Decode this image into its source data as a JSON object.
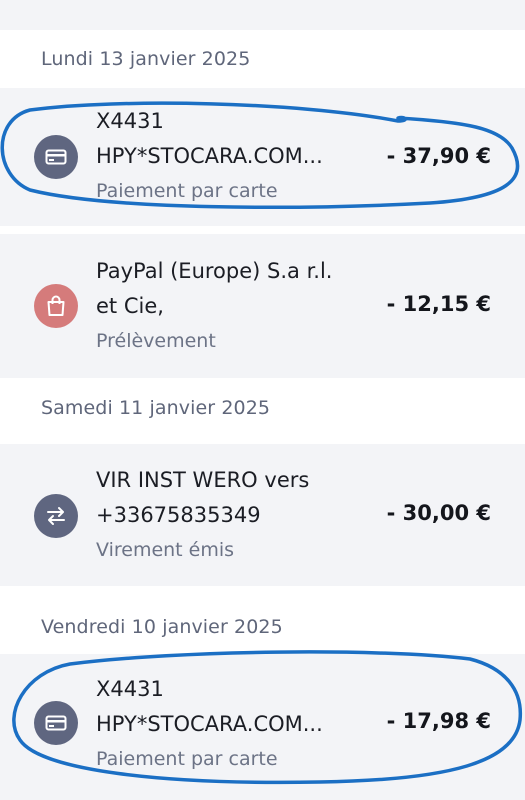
{
  "dates": {
    "d1": "Lundi 13 janvier 2025",
    "d2": "Samedi 11 janvier 2025",
    "d3": "Vendredi 10 janvier 2025"
  },
  "transactions": [
    {
      "line1": "X4431",
      "line2": "HPY*STOCARA.COM...",
      "type": "Paiement par carte",
      "amount": "- 37,90 €",
      "icon": "credit-card-icon",
      "icon_color": "#5f6680"
    },
    {
      "line1": "PayPal (Europe) S.a r.l.",
      "line2": "et Cie,",
      "type": "Prélèvement",
      "amount": "- 12,15 €",
      "icon": "shopping-bag-icon",
      "icon_color": "#d57b7b"
    },
    {
      "line1": "VIR INST WERO vers",
      "line2": "+33675835349",
      "type": "Virement émis",
      "amount": "- 30,00 €",
      "icon": "transfer-arrows-icon",
      "icon_color": "#5f6680"
    },
    {
      "line1": "X4431",
      "line2": "HPY*STOCARA.COM...",
      "type": "Paiement par carte",
      "amount": "- 17,98 €",
      "icon": "credit-card-icon",
      "icon_color": "#5f6680"
    }
  ],
  "colors": {
    "annotation_stroke": "#1b6fc4",
    "background": "#f3f4f7",
    "header_background": "#ffffff"
  }
}
